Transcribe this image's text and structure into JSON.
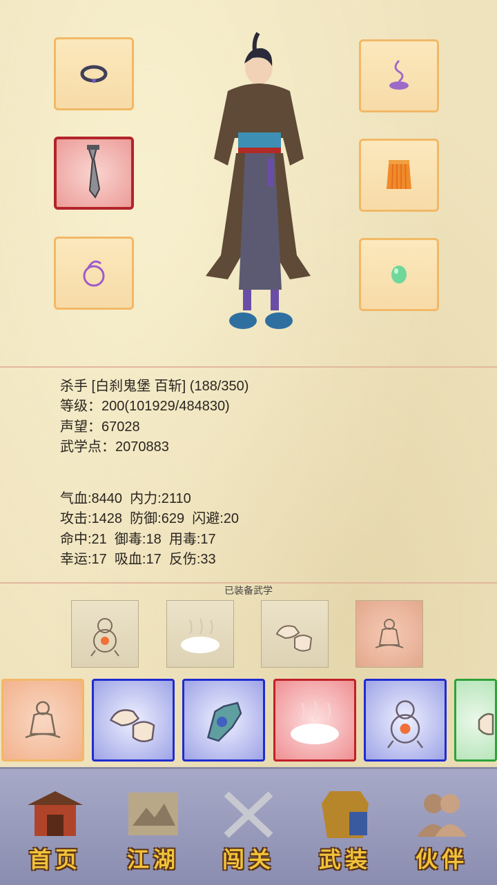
{
  "equipment": {
    "left": [
      "ring-icon",
      "sword-icon",
      "bracelet-icon"
    ],
    "right": [
      "incense-icon",
      "skirt-icon",
      "jade-icon"
    ]
  },
  "character": {
    "title_line": "杀手 [白刹鬼堡 百斩] (188/350)",
    "level_line": "等级：200(101929/484830)",
    "prestige_line": "声望：67028",
    "martial_points_line": "武学点：2070883"
  },
  "stats": [
    "气血:8440  内力:2110",
    "攻击:1428  防御:629  闪避:20",
    "命中:21  御毒:18  用毒:17",
    "幸运:17  吸血:17  反伤:33"
  ],
  "equipped_skills": {
    "title": "已装备武学",
    "icons": [
      "gourd-skill-icon",
      "mist-skill-icon",
      "fist-skill-icon",
      "meditation-skill-icon"
    ]
  },
  "skill_bar": [
    {
      "icon": "meditation-skill-icon",
      "tier": "orange"
    },
    {
      "icon": "fist-skill-icon",
      "tier": "blue"
    },
    {
      "icon": "palm-skill-icon",
      "tier": "blue"
    },
    {
      "icon": "mist-skill-icon",
      "tier": "red"
    },
    {
      "icon": "gourd-skill-icon",
      "tier": "blue"
    },
    {
      "icon": "fist-skill-icon",
      "tier": "green"
    }
  ],
  "nav": [
    {
      "label": "首页",
      "icon": "house-icon"
    },
    {
      "label": "江湖",
      "icon": "scroll-map-icon"
    },
    {
      "label": "闯关",
      "icon": "crossed-swords-icon"
    },
    {
      "label": "武装",
      "icon": "armor-icon"
    },
    {
      "label": "伙伴",
      "icon": "partners-icon"
    }
  ],
  "colors": {
    "accent_gold": "#f2c23a",
    "slot_border": "#f2b866",
    "rare_red": "#b2242a",
    "tier_blue": "#1f2bd0",
    "tier_green": "#2ea33a"
  }
}
